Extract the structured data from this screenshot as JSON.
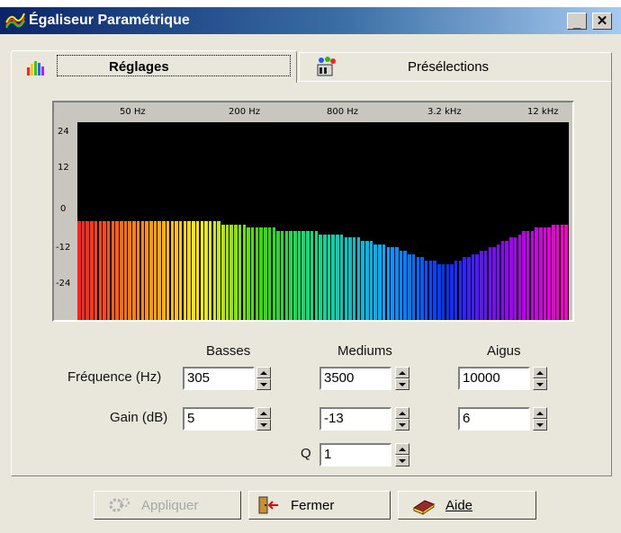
{
  "window": {
    "title": "Égaliseur Paramétrique",
    "minimize_symbol": "_",
    "close_symbol": "✕",
    "icon": "equalizer-icon"
  },
  "tabs": [
    {
      "label": "Réglages",
      "icon": "bars-chart-icon",
      "active": true
    },
    {
      "label": "Présélections",
      "icon": "presets-icon",
      "active": false
    }
  ],
  "equalizer": {
    "freq_labels": [
      "50 Hz",
      "200 Hz",
      "800 Hz",
      "3.2 kHz",
      "12 kHz"
    ],
    "db_labels": [
      "24",
      "12",
      "0",
      "-12",
      "-24"
    ],
    "db_range": [
      -30,
      30
    ],
    "gradient": [
      "#ff2020",
      "#ff8800",
      "#ffee00",
      "#33dd00",
      "#00dd99",
      "#00aaff",
      "#0033ff",
      "#9900ff",
      "#ff00cc"
    ],
    "bar_levels_db": [
      0,
      0,
      0,
      0,
      0,
      0,
      0,
      0,
      0,
      0,
      0,
      0,
      0,
      0,
      0,
      0,
      0,
      0,
      0,
      0,
      0,
      0,
      0,
      0,
      0,
      0,
      0,
      0,
      0,
      0,
      0,
      0,
      0,
      0,
      -1,
      -1,
      -1,
      -1,
      -1,
      -1,
      -2,
      -2,
      -2,
      -2,
      -2,
      -2,
      -2,
      -3,
      -3,
      -3,
      -3,
      -3,
      -3,
      -3,
      -3,
      -3,
      -3,
      -4,
      -4,
      -4,
      -4,
      -4,
      -4,
      -5,
      -5,
      -5,
      -5,
      -6,
      -6,
      -6,
      -7,
      -7,
      -7,
      -8,
      -8,
      -8,
      -9,
      -9,
      -10,
      -10,
      -11,
      -11,
      -12,
      -12,
      -12,
      -13,
      -13,
      -13,
      -13,
      -12,
      -12,
      -11,
      -11,
      -10,
      -10,
      -9,
      -9,
      -8,
      -8,
      -7,
      -6,
      -6,
      -5,
      -5,
      -4,
      -3,
      -3,
      -3,
      -2,
      -2,
      -2,
      -2,
      -1,
      -1,
      -1,
      -1
    ]
  },
  "controls": {
    "columns": [
      "Basses",
      "Mediums",
      "Aigus"
    ],
    "frequency_label": "Fréquence (Hz)",
    "gain_label": "Gain (dB)",
    "q_label": "Q",
    "frequency_values": [
      "305",
      "3500",
      "10000"
    ],
    "gain_values": [
      "5",
      "-13",
      "6"
    ],
    "q_value": "1"
  },
  "buttons": {
    "apply": {
      "label": "Appliquer",
      "enabled": false,
      "icon": "gears-icon"
    },
    "close": {
      "label": "Fermer",
      "enabled": true,
      "icon": "door-exit-icon"
    },
    "help": {
      "label": "Aide",
      "enabled": true,
      "icon": "help-book-icon"
    }
  }
}
